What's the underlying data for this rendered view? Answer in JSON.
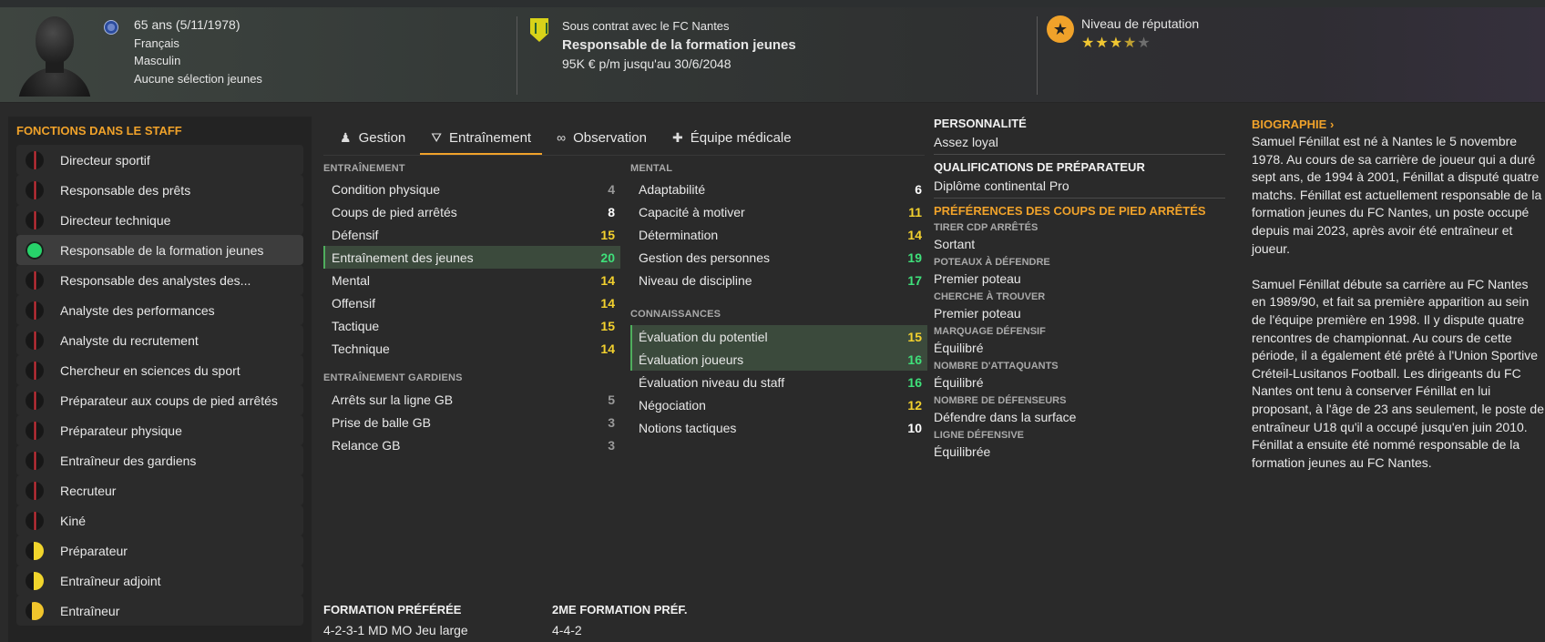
{
  "header": {
    "age": "65 ans (5/11/1978)",
    "nationality": "Français",
    "gender": "Masculin",
    "caps": "Aucune sélection jeunes",
    "contract_line": "Sous contrat avec le FC Nantes",
    "role": "Responsable de la formation jeunes",
    "salary": "95K € p/m jusqu'au 30/6/2048",
    "reputation_label": "Niveau de réputation",
    "reputation_stars": 3.5
  },
  "staff": {
    "title": "FONCTIONS DANS LE STAFF",
    "items": [
      {
        "label": "Directeur sportif",
        "level": "red"
      },
      {
        "label": "Responsable des prêts",
        "level": "red"
      },
      {
        "label": "Directeur technique",
        "level": "red"
      },
      {
        "label": "Responsable de la formation jeunes",
        "level": "green"
      },
      {
        "label": "Responsable des analystes des...",
        "level": "red"
      },
      {
        "label": "Analyste des performances",
        "level": "red"
      },
      {
        "label": "Analyste du recrutement",
        "level": "red"
      },
      {
        "label": "Chercheur en sciences du sport",
        "level": "red"
      },
      {
        "label": "Préparateur aux coups de pied arrêtés",
        "level": "red"
      },
      {
        "label": "Préparateur physique",
        "level": "red"
      },
      {
        "label": "Entraîneur des gardiens",
        "level": "red"
      },
      {
        "label": "Recruteur",
        "level": "red"
      },
      {
        "label": "Kiné",
        "level": "red"
      },
      {
        "label": "Préparateur",
        "level": "yellow"
      },
      {
        "label": "Entraîneur adjoint",
        "level": "yellow"
      },
      {
        "label": "Entraîneur",
        "level": "yellow-more"
      }
    ]
  },
  "tabs": [
    {
      "label": "Gestion",
      "icon": "person-icon"
    },
    {
      "label": "Entraînement",
      "icon": "training-cone-icon"
    },
    {
      "label": "Observation",
      "icon": "binoculars-icon"
    },
    {
      "label": "Équipe médicale",
      "icon": "medical-kit-icon"
    }
  ],
  "training": {
    "title": "ENTRAÎNEMENT",
    "rows": [
      {
        "label": "Condition physique",
        "value": 4,
        "color": "gray"
      },
      {
        "label": "Coups de pied arrêtés",
        "value": 8,
        "color": "white"
      },
      {
        "label": "Défensif",
        "value": 15,
        "color": "yellow"
      },
      {
        "label": "Entraînement des jeunes",
        "value": 20,
        "color": "green"
      },
      {
        "label": "Mental",
        "value": 14,
        "color": "yellow"
      },
      {
        "label": "Offensif",
        "value": 14,
        "color": "yellow"
      },
      {
        "label": "Tactique",
        "value": 15,
        "color": "yellow"
      },
      {
        "label": "Technique",
        "value": 14,
        "color": "yellow"
      }
    ]
  },
  "gk_training": {
    "title": "ENTRAÎNEMENT GARDIENS",
    "rows": [
      {
        "label": "Arrêts sur la ligne GB",
        "value": 5,
        "color": "gray"
      },
      {
        "label": "Prise de balle GB",
        "value": 3,
        "color": "gray"
      },
      {
        "label": "Relance GB",
        "value": 3,
        "color": "gray"
      }
    ]
  },
  "mental": {
    "title": "MENTAL",
    "rows": [
      {
        "label": "Adaptabilité",
        "value": 6,
        "color": "white"
      },
      {
        "label": "Capacité à motiver",
        "value": 11,
        "color": "yellow"
      },
      {
        "label": "Détermination",
        "value": 14,
        "color": "yellow"
      },
      {
        "label": "Gestion des personnes",
        "value": 19,
        "color": "green"
      },
      {
        "label": "Niveau de discipline",
        "value": 17,
        "color": "green"
      }
    ]
  },
  "knowledge": {
    "title": "CONNAISSANCES",
    "rows": [
      {
        "label": "Évaluation du potentiel",
        "value": 15,
        "color": "yellow"
      },
      {
        "label": "Évaluation joueurs",
        "value": 16,
        "color": "green"
      },
      {
        "label": "Évaluation niveau du staff",
        "value": 16,
        "color": "green"
      },
      {
        "label": "Négociation",
        "value": 12,
        "color": "yellow"
      },
      {
        "label": "Notions tactiques",
        "value": 10,
        "color": "white"
      }
    ]
  },
  "personality": {
    "title": "PERSONNALITÉ",
    "value": "Assez loyal",
    "coaching_title": "QUALIFICATIONS DE PRÉPARATEUR",
    "coaching_value": "Diplôme continental Pro",
    "setpiece_title": "PRÉFÉRENCES DES COUPS DE PIED ARRÊTÉS",
    "prefs": [
      {
        "label": "TIRER CDP ARRÊTÉS",
        "value": "Sortant"
      },
      {
        "label": "POTEAUX À DÉFENDRE",
        "value": "Premier poteau"
      },
      {
        "label": "CHERCHE À TROUVER",
        "value": "Premier poteau"
      },
      {
        "label": "MARQUAGE DÉFENSIF",
        "value": "Équilibré"
      },
      {
        "label": "NOMBRE D'ATTAQUANTS",
        "value": "Équilibré"
      },
      {
        "label": "NOMBRE DE DÉFENSEURS",
        "value": "Défendre dans la surface"
      },
      {
        "label": "LIGNE DÉFENSIVE",
        "value": "Équilibrée"
      }
    ]
  },
  "biography": {
    "title": "BIOGRAPHIE",
    "p1": "Samuel Fénillat est né à Nantes le 5 novembre 1978. Au cours de sa carrière de joueur qui a duré sept ans, de 1994 à 2001, Fénillat a disputé quatre matchs. Fénillat est actuellement responsable de la formation jeunes du FC Nantes, un poste occupé depuis mai 2023, après avoir été entraîneur et joueur.",
    "p2": "Samuel Fénillat débute sa carrière au FC Nantes en 1989/90, et fait sa première apparition au sein de l'équipe première en 1998. Il y dispute quatre rencontres de championnat. Au cours de cette période, il a également été prêté à l'Union Sportive Créteil-Lusitanos Football. Les dirigeants du FC Nantes ont tenu à conserver Fénillat en lui proposant, à l'âge de 23 ans seulement, le poste de entraîneur U18 qu'il a occupé jusqu'en juin 2010. Fénillat a ensuite été nommé responsable de la formation jeunes au FC Nantes."
  },
  "formations": {
    "pref_label": "FORMATION PRÉFÉRÉE",
    "pref_value": "4-2-3-1 MD MO Jeu large",
    "second_label": "2ME FORMATION PRÉF.",
    "second_value": "4-4-2"
  }
}
